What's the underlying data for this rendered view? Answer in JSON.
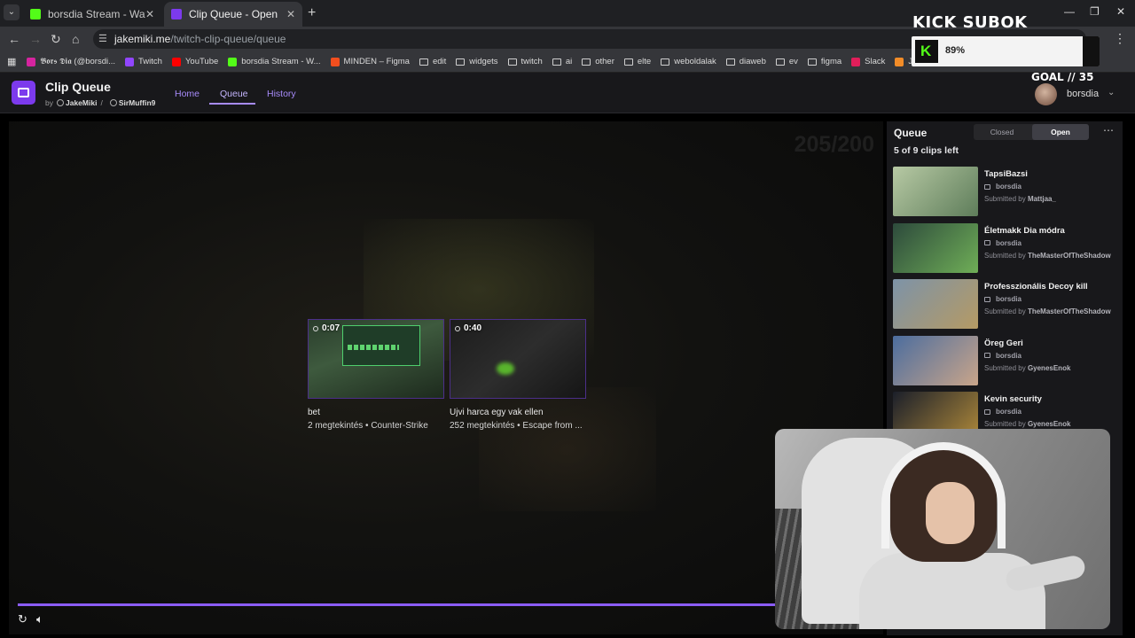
{
  "browser": {
    "tabs": [
      {
        "title": "borsdia Stream - Watch Live on",
        "active": false
      },
      {
        "title": "Clip Queue - Open",
        "active": true
      }
    ],
    "url_host": "jakemiki.me",
    "url_path": "/twitch-clip-queue/queue",
    "bookmarks": [
      {
        "label": "𝕭𝖔𝖗𝖘 𝕯𝖎𝖆 (@borsdi...",
        "icon": "instagram-icon",
        "color": "#d6249f"
      },
      {
        "label": "Twitch",
        "icon": "twitch-icon",
        "color": "#9146ff"
      },
      {
        "label": "YouTube",
        "icon": "youtube-icon",
        "color": "#ff0000"
      },
      {
        "label": "borsdia Stream - W...",
        "icon": "kick-icon",
        "color": "#53fc18"
      },
      {
        "label": "MINDEN – Figma",
        "icon": "figma-icon",
        "color": "#f24e1e"
      },
      {
        "label": "edit",
        "icon": "folder-icon"
      },
      {
        "label": "widgets",
        "icon": "folder-icon"
      },
      {
        "label": "twitch",
        "icon": "folder-icon"
      },
      {
        "label": "ai",
        "icon": "folder-icon"
      },
      {
        "label": "other",
        "icon": "folder-icon"
      },
      {
        "label": "elte",
        "icon": "folder-icon"
      },
      {
        "label": "weboldalak",
        "icon": "folder-icon"
      },
      {
        "label": "diaweb",
        "icon": "folder-icon"
      },
      {
        "label": "ev",
        "icon": "folder-icon"
      },
      {
        "label": "figma",
        "icon": "folder-icon"
      },
      {
        "label": "Slack",
        "icon": "slack-icon",
        "color": "#e01e5a"
      },
      {
        "label": "JELENTKEZŐK -",
        "icon": "spark-icon",
        "color": "#f28c28"
      }
    ]
  },
  "app": {
    "title": "Clip Queue",
    "by": "by",
    "author1": "JakeMiki",
    "author2": "SirMuffin9",
    "nav": [
      "Home",
      "Queue",
      "History"
    ],
    "user": "borsdia"
  },
  "player": {
    "counter": "205/200",
    "progress": 0.9,
    "recommended": [
      {
        "duration": "0:07",
        "title": "bet",
        "meta": "2 megtekintés • Counter-Strike"
      },
      {
        "duration": "0:40",
        "title": "Ujvi harca egy vak ellen",
        "meta": "252 megtekintés • Escape from ..."
      }
    ]
  },
  "queue": {
    "title": "Queue",
    "toggle_closed": "Closed",
    "toggle_open": "Open",
    "selected": "Open",
    "count": "5 of 9 clips left",
    "items": [
      {
        "title": "TapsiBazsi",
        "channel": "borsdia",
        "submitted_label": "Submitted by",
        "submitter": "Mattjaa_",
        "thumb": [
          "#b7c9a4",
          "#5e7d5a"
        ]
      },
      {
        "title": "Életmakk Dia módra",
        "channel": "borsdia",
        "submitted_label": "Submitted by",
        "submitter": "TheMasterOfTheShadow",
        "thumb": [
          "#2d4a3c",
          "#6fae57"
        ]
      },
      {
        "title": "Professzionális Decoy kill",
        "channel": "borsdia",
        "submitted_label": "Submitted by",
        "submitter": "TheMasterOfTheShadow",
        "thumb": [
          "#7d93a8",
          "#b59a64"
        ]
      },
      {
        "title": "Öreg Geri",
        "channel": "borsdia",
        "submitted_label": "Submitted by",
        "submitter": "GyenesEnok",
        "thumb": [
          "#4c6d9e",
          "#c9a58a"
        ]
      },
      {
        "title": "Kevin security",
        "channel": "borsdia",
        "submitted_label": "Submitted by",
        "submitter": "GyenesEnok",
        "thumb": [
          "#1b1f2a",
          "#b08a3a"
        ]
      }
    ]
  },
  "overlay": {
    "goal_title": "KICK SUBOK",
    "goal_percent": "89%",
    "goal_label": "GOAL // 35"
  }
}
